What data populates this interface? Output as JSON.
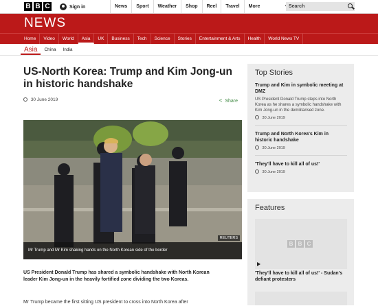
{
  "top_bar": {
    "logo_letters": [
      "B",
      "B",
      "C"
    ],
    "signin_label": "Sign in",
    "nav": [
      "News",
      "Sport",
      "Weather",
      "Shop",
      "Reel",
      "Travel"
    ],
    "more_label": "More",
    "more_chevron": "▾",
    "search_placeholder": "Search"
  },
  "masthead": {
    "title": "NEWS",
    "color": "#bb1919"
  },
  "main_nav": [
    "Home",
    "Video",
    "World",
    "Asia",
    "UK",
    "Business",
    "Tech",
    "Science",
    "Stories",
    "Entertainment & Arts",
    "Health",
    "World News TV"
  ],
  "main_nav_active": "Asia",
  "sub_nav": [
    "Asia",
    "China",
    "India"
  ],
  "article": {
    "headline": "US-North Korea: Trump and Kim Jong-un in historic handshake",
    "date": "30 June 2019",
    "share_label": "Share",
    "image_caption": "Mr Trump and Mr Kim shaking hands on the North Korean side of the border",
    "image_credit": "REUTERS",
    "intro": "US President Donald Trump has shared a symbolic handshake with North Korean leader Kim Jong-un in the heavily fortified zone dividing the two Koreas.",
    "paragraph": "Mr Trump became the first sitting US president to cross into North Korea after"
  },
  "top_stories": {
    "title": "Top Stories",
    "items": [
      {
        "title": "Trump and Kim in symbolic meeting at DMZ",
        "summary": "US President Donald Trump steps into North Korea as he shares a symbolic handshake with Kim Jong-un in the demilitarised zone.",
        "date": "30 June 2019"
      },
      {
        "title": "Trump and North Korea's Kim in historic handshake",
        "date": "30 June 2019"
      },
      {
        "title": "'They'll have to kill all of us!'",
        "date": "30 June 2019"
      }
    ]
  },
  "features": {
    "title": "Features",
    "placeholder_letters": [
      "B",
      "B",
      "C"
    ],
    "items": [
      {
        "title": "'They'll have to kill all of us!' - Sudan's defiant protesters"
      }
    ]
  }
}
